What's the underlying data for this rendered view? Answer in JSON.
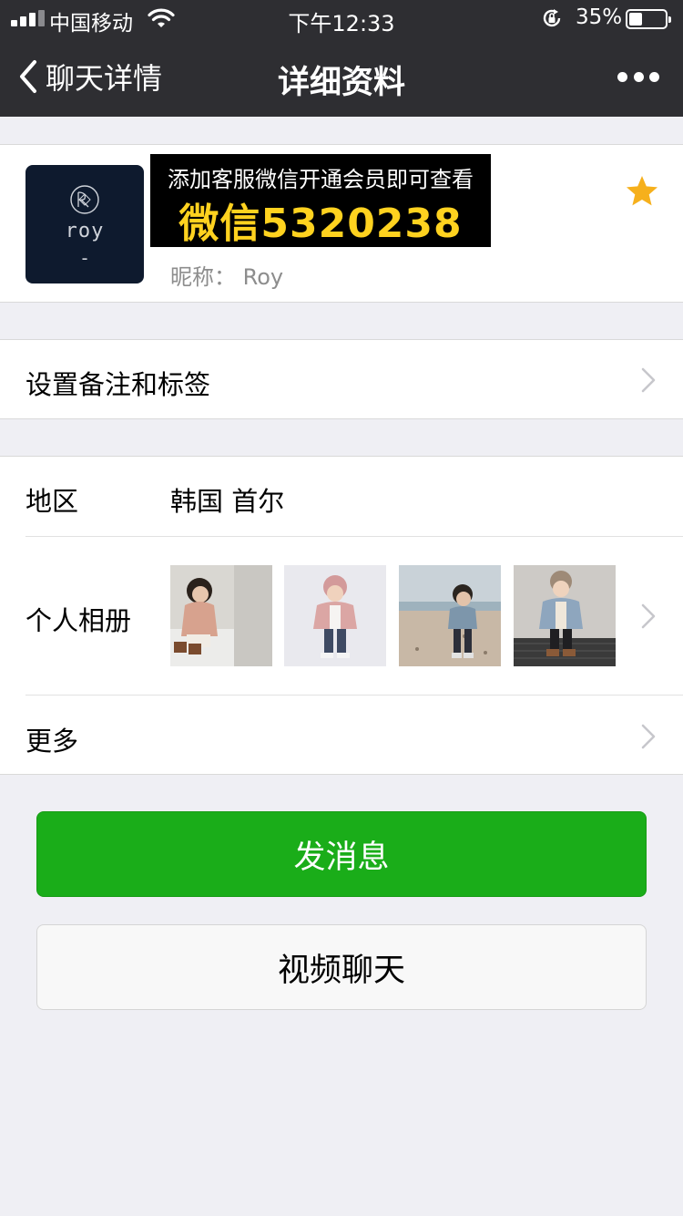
{
  "status_bar": {
    "carrier": "中国移动",
    "time": "下午12:33",
    "battery_percent": "35%",
    "battery_level": 0.35
  },
  "nav": {
    "back_label": "聊天详情",
    "title": "详细资料",
    "more_icon": "more-dots-icon"
  },
  "profile": {
    "avatar": {
      "text": "roy",
      "mark": "-",
      "background": "#0e1a2e"
    },
    "overlay": {
      "line1": "添加客服微信开通会员即可查看",
      "line2": "微信5320238"
    },
    "nickname": "昵称：  Roy",
    "starred": true,
    "star_color": "#f6b01c"
  },
  "remark_row": {
    "label": "设置备注和标签"
  },
  "region_row": {
    "label": "地区",
    "value": "韩国 首尔"
  },
  "album_row": {
    "label": "个人相册",
    "photos": [
      "photo-child-pink-coat-sitting",
      "photo-child-pink-coat-standing",
      "photo-child-beach",
      "photo-child-denim-jacket"
    ]
  },
  "more_row": {
    "label": "更多"
  },
  "buttons": {
    "send_message": "发消息",
    "video_call": "视频聊天"
  },
  "colors": {
    "nav_bg": "#2e2e32",
    "page_bg": "#efeff4",
    "primary_green": "#1aad19",
    "overlay_text": "#ffd21f"
  }
}
